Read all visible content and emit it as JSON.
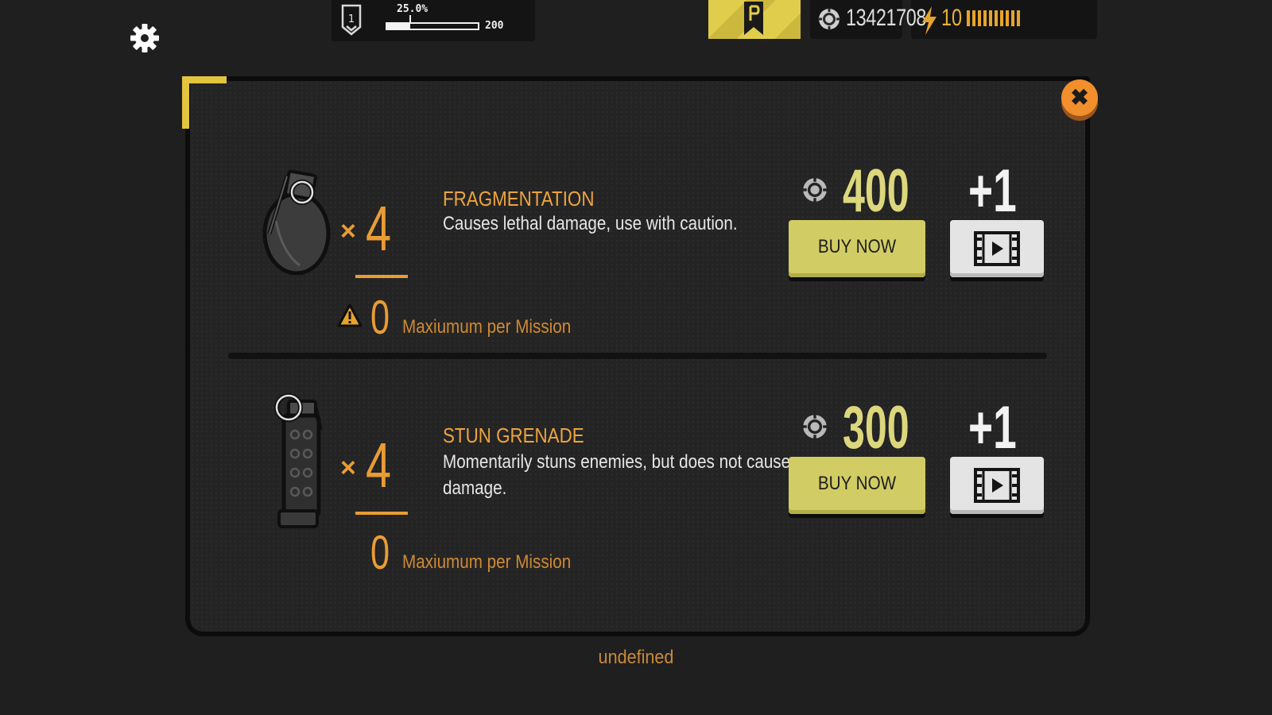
{
  "hud": {
    "settings_icon": "gear-icon",
    "rank": {
      "level": "1",
      "icon": "rank-chevron-icon"
    },
    "xp": {
      "percent_label": "25.0%",
      "progress": 0.25,
      "max_label": "200"
    },
    "ribbon_icon": "pass-ribbon-icon",
    "coins": {
      "icon": "coin-icon",
      "total": "13421708"
    },
    "energy": {
      "icon": "lightning-bolt-icon",
      "count": "10",
      "bars_filled": 10,
      "bars_total": 10
    }
  },
  "modal": {
    "close_icon": "close-icon",
    "items": [
      {
        "icon": "frag-grenade-icon",
        "times_symbol": "×",
        "quantity": "4",
        "max_per_mission": "0",
        "max_label": "Maxiumum per Mission",
        "warning_icon": "warning-triangle-icon",
        "name": "FRAGMENTATION",
        "description": "Causes lethal damage, use with caution.",
        "price": "400",
        "buy_label": "BUY NOW",
        "bonus_label": "+1",
        "video_icon": "video-film-icon"
      },
      {
        "icon": "stun-grenade-icon",
        "times_symbol": "×",
        "quantity": "4",
        "max_per_mission": "0",
        "max_label": "Maxiumum per Mission",
        "name": "STUN GRENADE",
        "description": "Momentarily stuns enemies, but does not cause damage.",
        "price": "300",
        "buy_label": "BUY NOW",
        "bonus_label": "+1",
        "video_icon": "video-film-icon"
      }
    ]
  },
  "footer": {
    "text": "undefined"
  },
  "colors": {
    "accent_yellow": "#e3c43e",
    "orange": "#e99c35",
    "buy_button": "#d2cc65",
    "close_button": "#f08f2c",
    "background": "#1f1f1f"
  }
}
